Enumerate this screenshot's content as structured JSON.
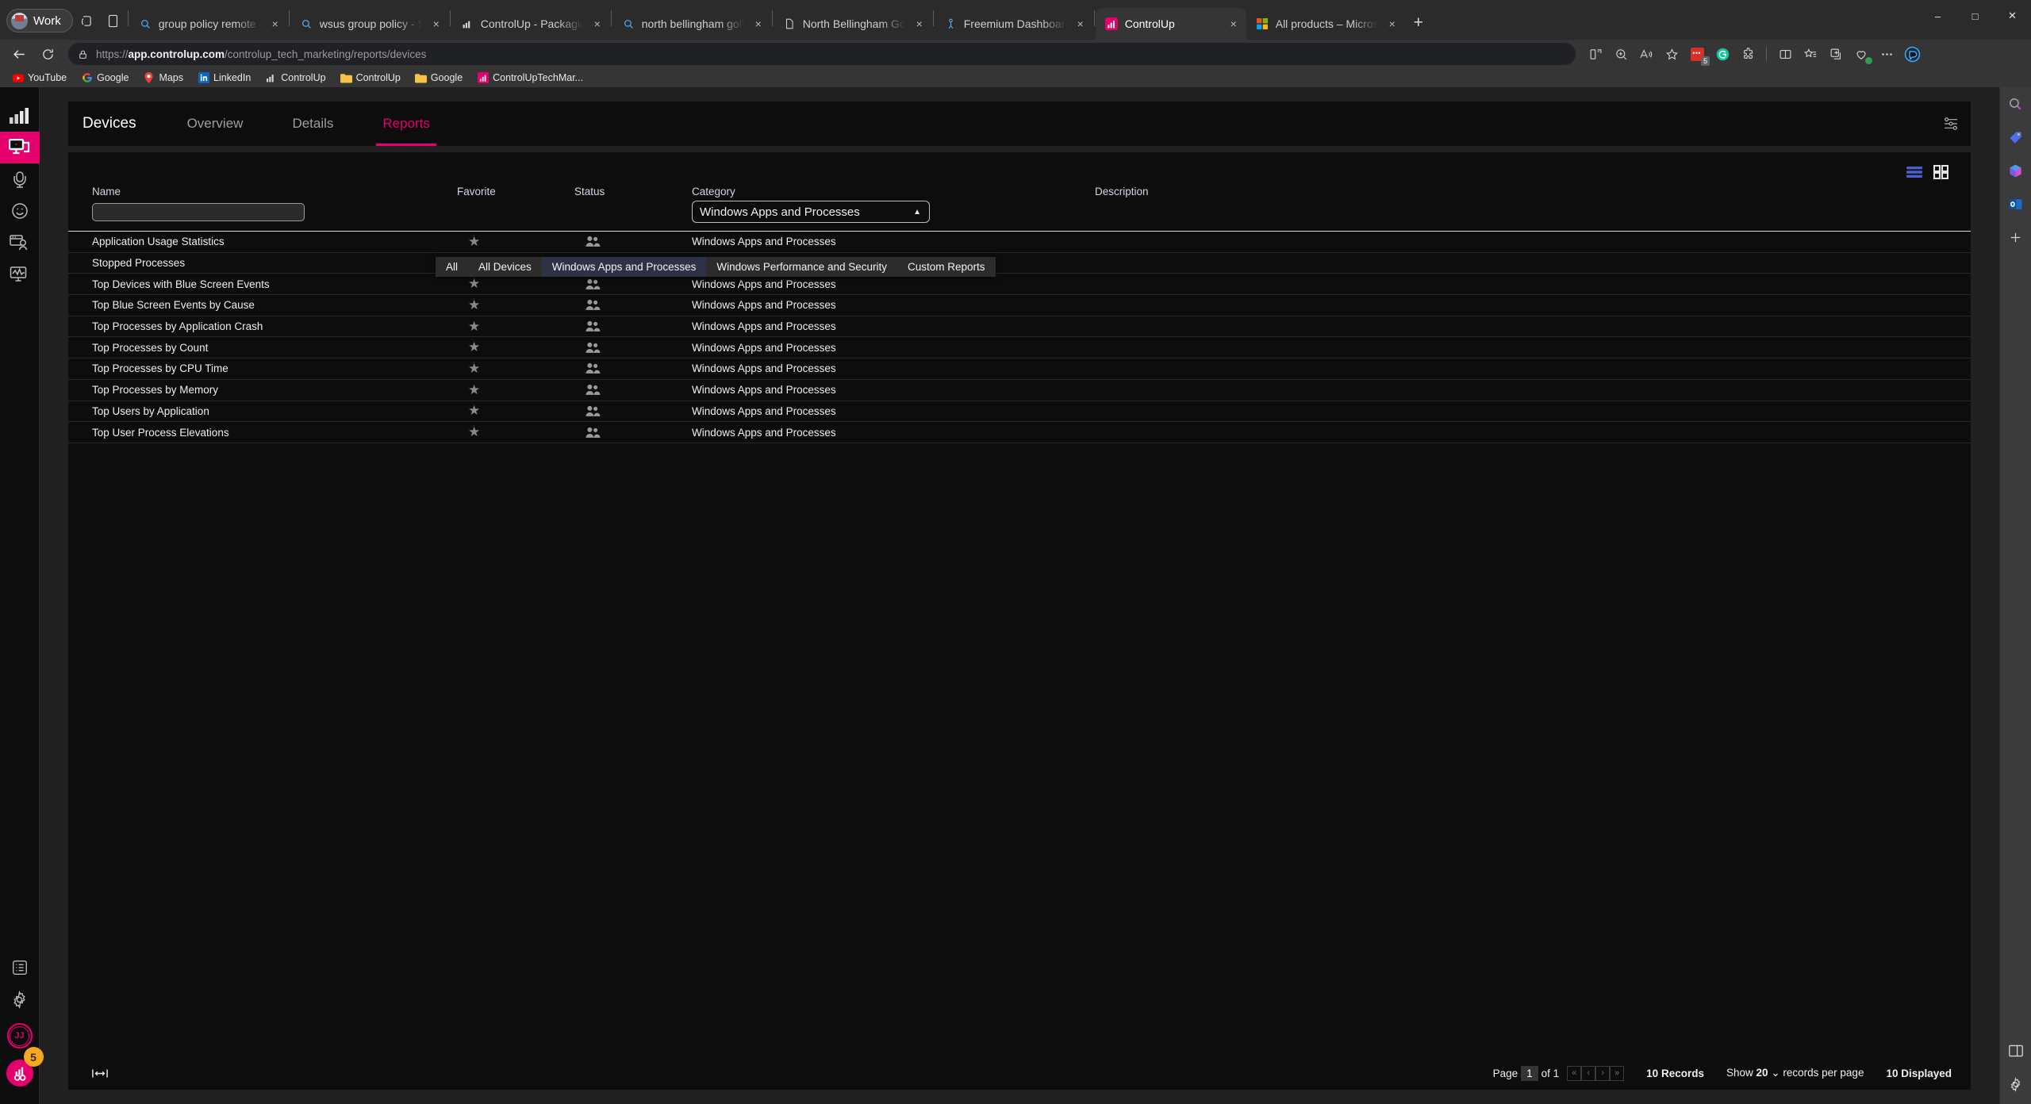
{
  "browser": {
    "profile": {
      "label": "Work",
      "icon": "user-avatar-icon"
    },
    "tabs": [
      {
        "title": "group policy remote desktop - S",
        "icon": "search-icon",
        "active": false
      },
      {
        "title": "wsus group policy - Search",
        "icon": "search-icon",
        "active": false
      },
      {
        "title": "ControlUp - Packaging & Pricing",
        "icon": "controlup-icon",
        "active": false
      },
      {
        "title": "north bellingham golf course - S",
        "icon": "search-icon",
        "active": false
      },
      {
        "title": "North Bellingham Golf Course",
        "icon": "page-icon",
        "active": false
      },
      {
        "title": "Freemium Dashboard › Freemium",
        "icon": "freemium-icon",
        "active": false
      },
      {
        "title": "ControlUp",
        "icon": "controlup-icon",
        "active": true
      },
      {
        "title": "All products – Microsoft Azure M",
        "icon": "microsoft-icon",
        "active": false
      }
    ],
    "tab_close_label": "×",
    "new_tab_label": "+",
    "window_controls": {
      "minimize": "–",
      "maximize": "□",
      "close": "✕"
    },
    "nav": {
      "back": "←",
      "refresh": "↻",
      "url_scheme": "https://",
      "url_host": "app.controlup.com",
      "url_path": "/controlup_tech_marketing/reports/devices",
      "lock_icon": "lock-icon"
    },
    "toolbar_right": [
      "split-screen-icon",
      "zoom-icon",
      "read-aloud-icon",
      "add-favorite-icon",
      "extension-red-badge-icon",
      "grammarly-icon",
      "extensions-icon",
      "browser-essentials-split-icon",
      "favorites-icon",
      "collections-icon",
      "browser-health-icon",
      "more-icon",
      "copilot-icon"
    ],
    "extension_badge_count": "5",
    "bookmarks": [
      {
        "label": "YouTube",
        "icon": "youtube-icon"
      },
      {
        "label": "Google",
        "icon": "google-icon"
      },
      {
        "label": "Maps",
        "icon": "maps-pin-icon"
      },
      {
        "label": "LinkedIn",
        "icon": "linkedin-icon"
      },
      {
        "label": "ControlUp",
        "icon": "controlup-icon"
      },
      {
        "label": "ControlUp",
        "icon": "folder-icon"
      },
      {
        "label": "Google",
        "icon": "folder-icon"
      },
      {
        "label": "ControlUpTechMar...",
        "icon": "controlup-icon"
      }
    ],
    "right_rail": [
      "search-icon",
      "shopping-tag-icon",
      "microsoft-365-icon",
      "outlook-icon",
      "add-icon"
    ],
    "right_rail_bottom": [
      "split-pane-icon",
      "gear-icon"
    ]
  },
  "app": {
    "sidebar": {
      "items": [
        {
          "name": "analytics",
          "icon": "bar-chart-icon",
          "active": false
        },
        {
          "name": "devices",
          "icon": "monitor-icon",
          "active": true
        },
        {
          "name": "support",
          "icon": "headset-icon",
          "active": false
        },
        {
          "name": "experience",
          "icon": "smiley-icon",
          "active": false
        },
        {
          "name": "user-sessions",
          "icon": "window-user-icon",
          "active": false
        },
        {
          "name": "monitoring",
          "icon": "monitor-pulse-icon",
          "active": false
        }
      ],
      "bottom_items": [
        {
          "name": "activity-log",
          "icon": "list-icon"
        },
        {
          "name": "settings",
          "icon": "gear-icon"
        }
      ],
      "avatar_initials": "JJ",
      "logo_icon": "controlup-logo-icon",
      "logo_badge": "5"
    },
    "tabs": [
      {
        "label": "Devices",
        "active": false,
        "is_title": true
      },
      {
        "label": "Overview",
        "active": false
      },
      {
        "label": "Details",
        "active": false
      },
      {
        "label": "Reports",
        "active": true
      }
    ],
    "tabs_right_icon": "sliders-icon",
    "view_toggles": [
      {
        "name": "list-view",
        "icon": "list-view-icon",
        "active": true
      },
      {
        "name": "grid-view",
        "icon": "grid-view-icon",
        "active": false
      }
    ],
    "table": {
      "columns": [
        "Name",
        "Favorite",
        "Status",
        "Category",
        "Description"
      ],
      "name_filter_value": "",
      "name_filter_placeholder": "",
      "category_filter_value": "Windows Apps and Processes",
      "category_caret": "▲",
      "category_options": [
        {
          "label": "All",
          "selected": false
        },
        {
          "label": "All Devices",
          "selected": false
        },
        {
          "label": "Windows Apps and Processes",
          "selected": true
        },
        {
          "label": "Windows Performance and Security",
          "selected": false
        },
        {
          "label": "Custom Reports",
          "selected": false
        }
      ],
      "star_glyph": "★",
      "status_icon": "people-group-icon",
      "rows": [
        {
          "name": "Application Usage Statistics",
          "category": "Windows Apps and Processes",
          "description": ""
        },
        {
          "name": "Stopped Processes",
          "category": "Windows Apps and Processes",
          "description": ""
        },
        {
          "name": "Top Devices with Blue Screen Events",
          "category": "Windows Apps and Processes",
          "description": ""
        },
        {
          "name": "Top Blue Screen Events by Cause",
          "category": "Windows Apps and Processes",
          "description": ""
        },
        {
          "name": "Top Processes by Application Crash",
          "category": "Windows Apps and Processes",
          "description": ""
        },
        {
          "name": "Top Processes by Count",
          "category": "Windows Apps and Processes",
          "description": ""
        },
        {
          "name": "Top Processes by CPU Time",
          "category": "Windows Apps and Processes",
          "description": ""
        },
        {
          "name": "Top Processes by Memory",
          "category": "Windows Apps and Processes",
          "description": ""
        },
        {
          "name": "Top Users by Application",
          "category": "Windows Apps and Processes",
          "description": ""
        },
        {
          "name": "Top User Process Elevations",
          "category": "Windows Apps and Processes",
          "description": ""
        }
      ]
    },
    "footer": {
      "fit_columns_icon": "fit-width-icon",
      "page_label": "Page",
      "page_number": "1",
      "of_label": "of 1",
      "first_page": "«",
      "prev_page": "‹",
      "next_page": "›",
      "last_page": "»",
      "records_total": "10 Records",
      "show_label": "Show",
      "page_size": "20",
      "page_size_caret": "⌄",
      "per_page_label": "records per page",
      "displayed": "10 Displayed"
    }
  },
  "colors": {
    "accent": "#e5006d",
    "panel_bg": "#0d0d0d",
    "badge": "#f5a623",
    "dd_selected": "#2e3247"
  }
}
